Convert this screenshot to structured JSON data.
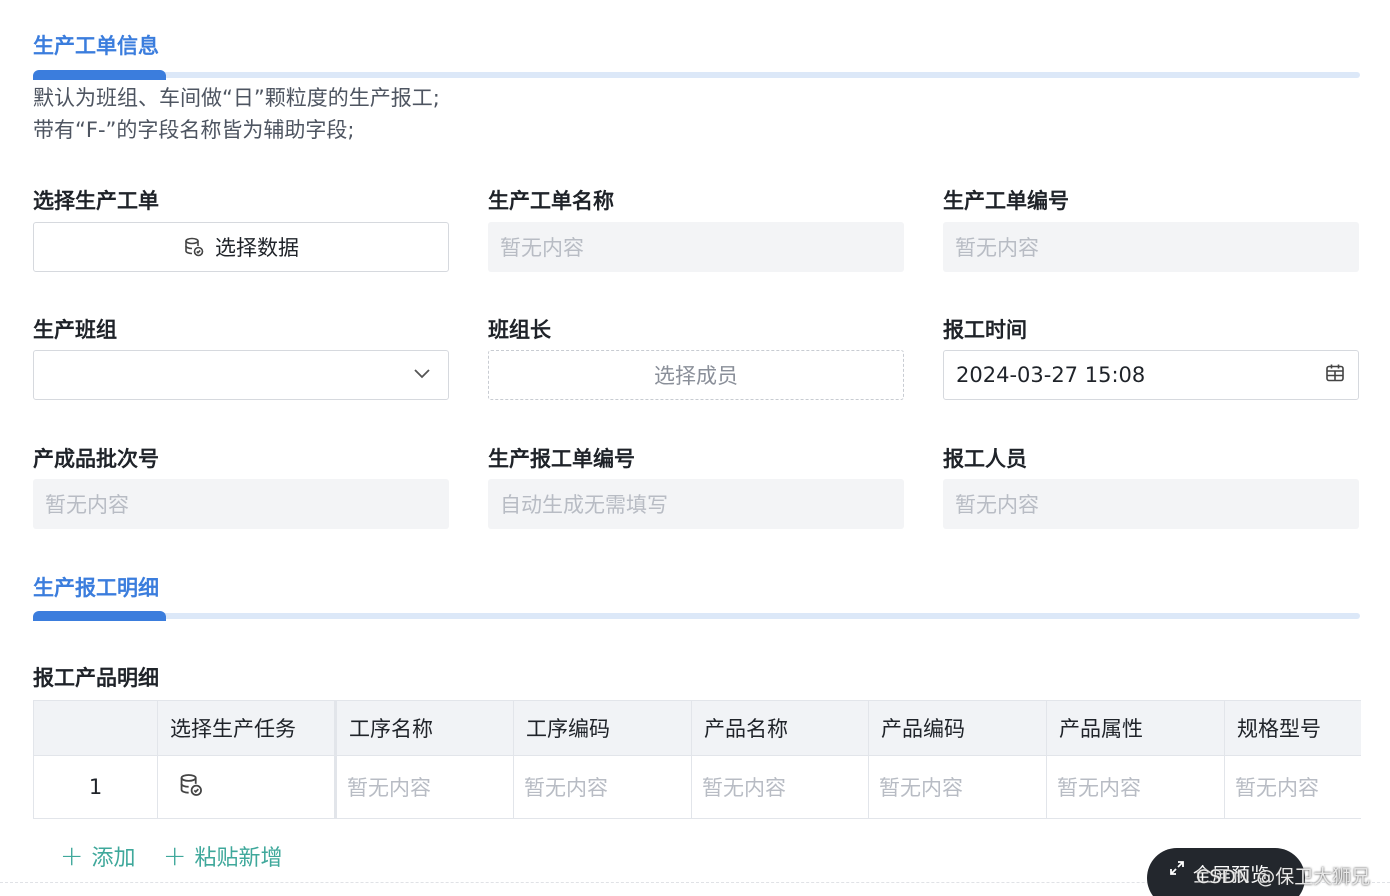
{
  "section1": {
    "title": "生产工单信息",
    "desc_line1": "默认为班组、车间做“日”颗粒度的生产报工;",
    "desc_line2": "带有“F-”的字段名称皆为辅助字段;"
  },
  "fields": {
    "select_order_label": "选择生产工单",
    "select_order_button": "选择数据",
    "order_name_label": "生产工单名称",
    "order_name_value": "暂无内容",
    "order_no_label": "生产工单编号",
    "order_no_value": "暂无内容",
    "team_label": "生产班组",
    "team_value": "",
    "leader_label": "班组长",
    "leader_button": "选择成员",
    "report_time_label": "报工时间",
    "report_time_value": "2024-03-27 15:08",
    "batch_label": "产成品批次号",
    "batch_value": "暂无内容",
    "report_no_label": "生产报工单编号",
    "report_no_value": "自动生成无需填写",
    "reporter_label": "报工人员",
    "reporter_value": "暂无内容"
  },
  "section2": {
    "title": "生产报工明细",
    "subhead": "报工产品明细"
  },
  "table": {
    "headers": [
      "",
      "选择生产任务",
      "工序名称",
      "工序编码",
      "产品名称",
      "产品编码",
      "产品属性",
      "规格型号"
    ],
    "rows": [
      {
        "index": "1",
        "cells": [
          "暂无内容",
          "暂无内容",
          "暂无内容",
          "暂无内容",
          "暂无内容",
          "暂无内容"
        ]
      }
    ]
  },
  "actions": {
    "add": "添加",
    "paste_add": "粘贴新增",
    "fullscreen_preview": "全屏预览"
  },
  "watermark": "CSDN @保卫大狮兄",
  "colors": {
    "accent": "#3b7ddd",
    "link": "#3fa89b",
    "placeholder": "#b8bcc4"
  }
}
